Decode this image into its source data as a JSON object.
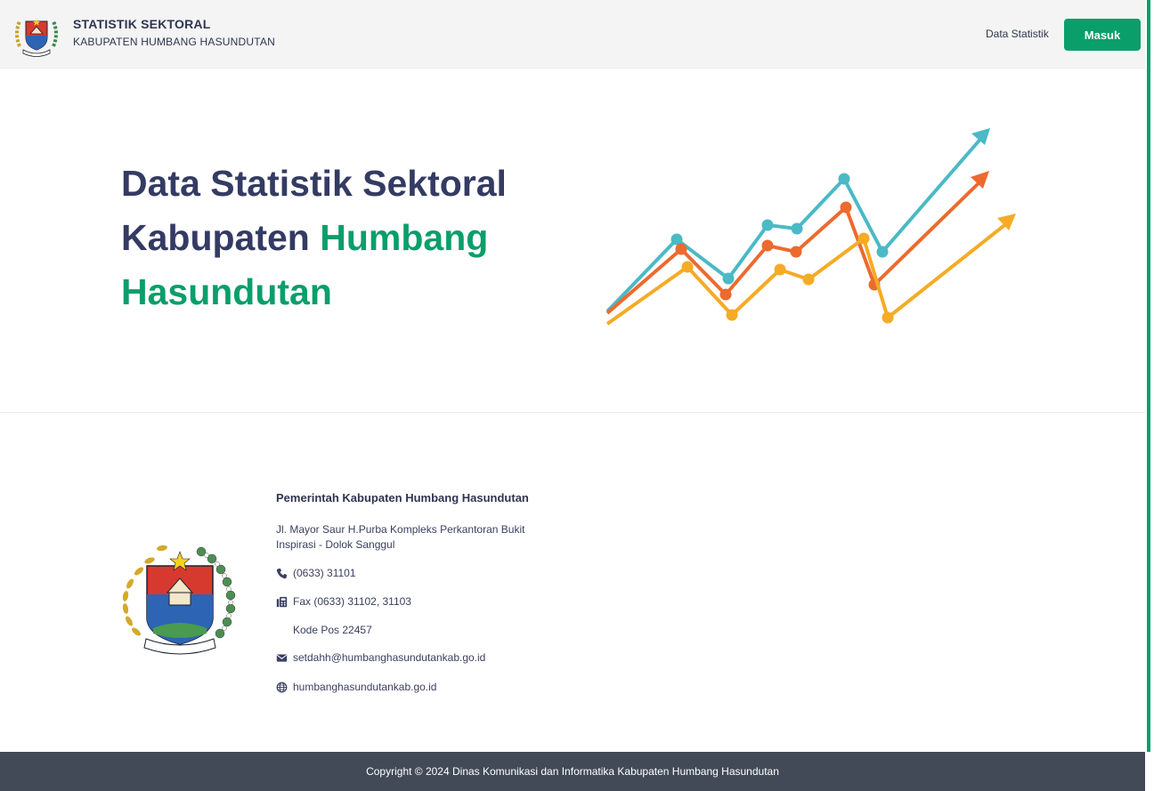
{
  "header": {
    "title": "STATISTIK SEKTORAL",
    "subtitle": "KABUPATEN HUMBANG HASUNDUTAN",
    "nav_data_statistik": "Data Statistik",
    "login_label": "Masuk"
  },
  "hero": {
    "line1": "Data Statistik Sektoral",
    "line2_part1": "Kabupaten ",
    "line2_accent": "Humbang",
    "line3_accent": "Hasundutan"
  },
  "footer": {
    "org_name": "Pemerintah Kabupaten Humbang Hasundutan",
    "address": "Jl. Mayor Saur H.Purba Kompleks Perkantoran Bukit Inspirasi - Dolok Sanggul",
    "phone": "(0633) 31101",
    "fax": "Fax (0633) 31102, 31103",
    "postal": "Kode Pos 22457",
    "email": "setdahh@humbanghasundutankab.go.id",
    "website": "humbanghasundutankab.go.id"
  },
  "copyright": "Copyright © 2024 Dinas Komunikasi dan Informatika Kabupaten Humbang Hasundutan",
  "colors": {
    "accent": "#0a9e6b",
    "heading": "#343b63",
    "footer_bar": "#424a57",
    "chart_teal": "#4bb9c6",
    "chart_orange": "#ec6a2e",
    "chart_yellow": "#f5ab26"
  },
  "icons": {
    "phone": "phone-icon",
    "fax": "fax-icon",
    "email": "envelope-icon",
    "website": "globe-icon"
  }
}
